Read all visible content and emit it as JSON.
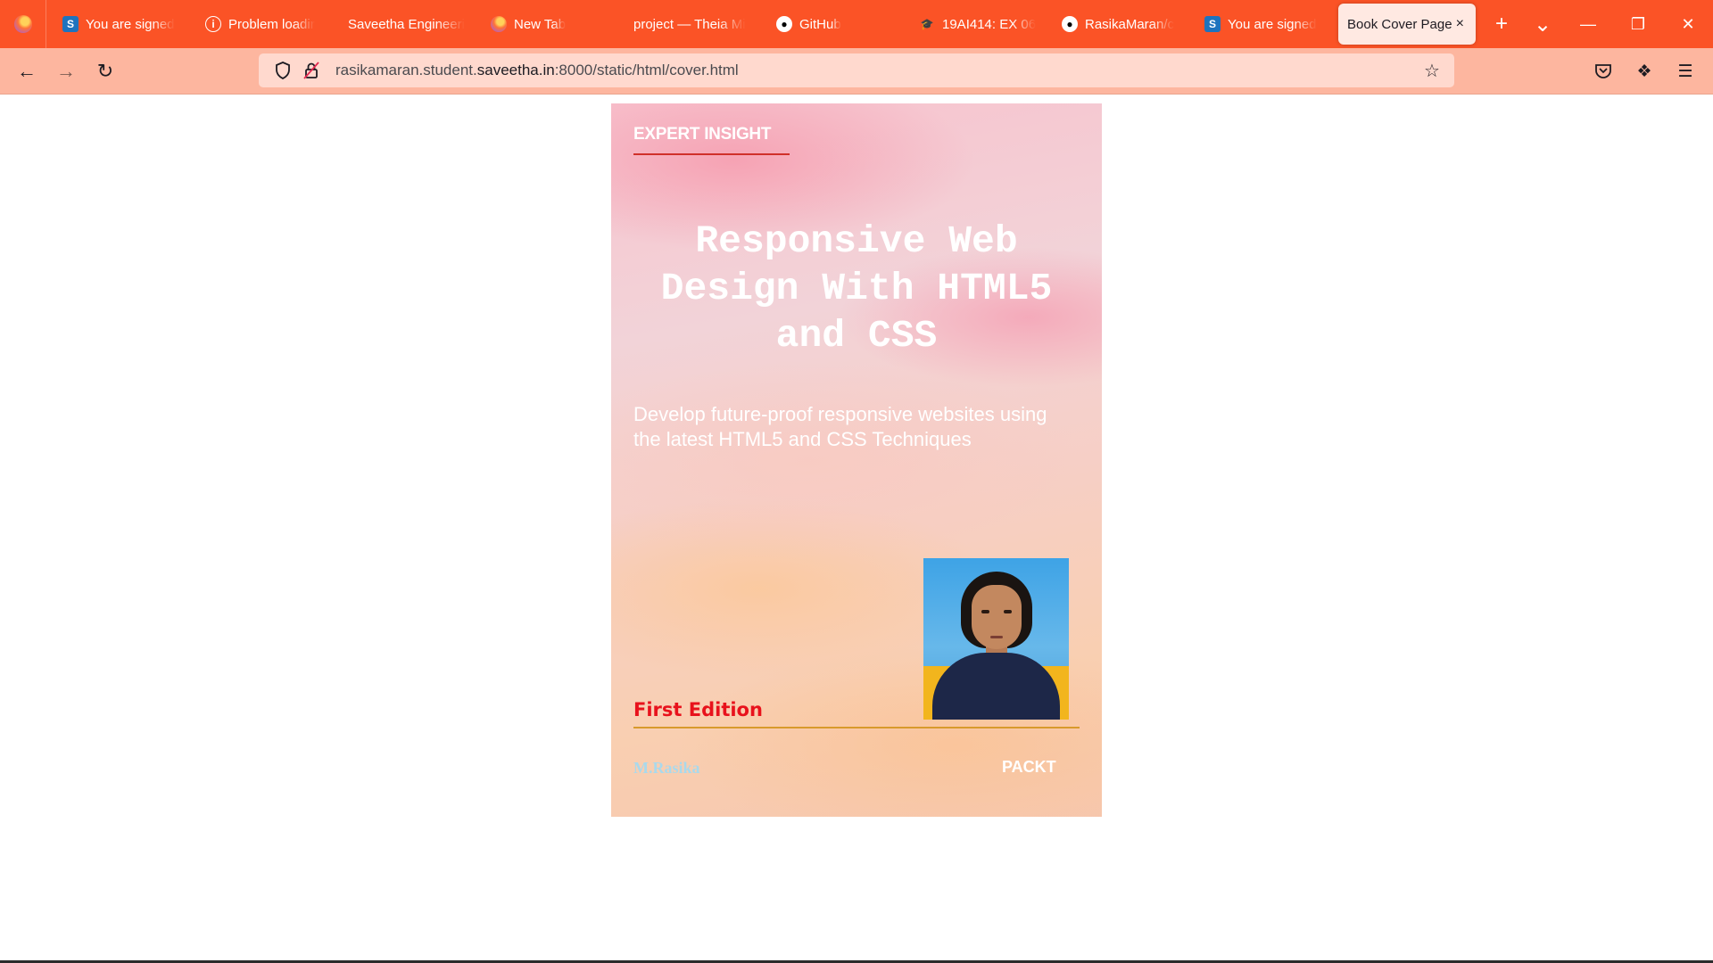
{
  "browser": {
    "tabs": [
      {
        "label": "You are signed",
        "icon": "s-icon"
      },
      {
        "label": "Problem loadir",
        "icon": "info-icon"
      },
      {
        "label": "Saveetha Engineeri",
        "icon": "none"
      },
      {
        "label": "New Tab",
        "icon": "firefox-icon"
      },
      {
        "label": "project — Theia Mi",
        "icon": "none"
      },
      {
        "label": "GitHub",
        "icon": "github-icon"
      },
      {
        "label": "19AI414: EX 06",
        "icon": "graduation-hat-icon"
      },
      {
        "label": "RasikaMaran/c",
        "icon": "github-icon"
      },
      {
        "label": "You are signed",
        "icon": "s-icon"
      },
      {
        "label": "Book Cover Page",
        "icon": "none",
        "active": true
      }
    ],
    "tab_close_glyph": "×",
    "new_tab_glyph": "+",
    "tab_list_glyph": "⌄",
    "url": {
      "prefix": "rasikamaran.student.",
      "domain": "saveetha.in",
      "suffix": ":8000/static/html/cover.html"
    },
    "colors": {
      "tabstrip": "#fb5326",
      "navbar": "#fdb69f",
      "urlbar": "#ffd9ce"
    }
  },
  "cover": {
    "label": "EXPERT INSIGHT",
    "title": "Responsive Web Design With HTML5 and CSS",
    "subtitle": "Develop future-proof responsive websites using the latest HTML5 and CSS Techniques",
    "edition": "First Edition",
    "author": "M.Rasika",
    "publisher": "PACKT",
    "colors": {
      "edition": "#e8121c",
      "author": "#a9d9ec",
      "rule_top": "#d0302a",
      "rule_bottom": "#d89a2c"
    }
  }
}
